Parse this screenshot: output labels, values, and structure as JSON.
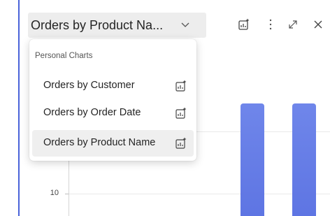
{
  "header": {
    "chart_selector_label": "Orders by Product Na...",
    "icons": {
      "new_chart": "new-chart-icon",
      "more": "more-options-icon",
      "expand": "expand-icon",
      "close": "close-icon"
    }
  },
  "dropdown": {
    "group_header": "Personal Charts",
    "items": [
      {
        "label": "Orders by Customer",
        "icon": "chart-sparkle-icon",
        "selected": false
      },
      {
        "label": "Orders by Order Date",
        "icon": "chart-sparkle-icon",
        "selected": false
      },
      {
        "label": "Orders by Product Name",
        "icon": "chart-sparkle-icon",
        "selected": true
      }
    ]
  },
  "chart": {
    "visible_y_tick": "10",
    "bar_color": "#6a80e8"
  }
}
